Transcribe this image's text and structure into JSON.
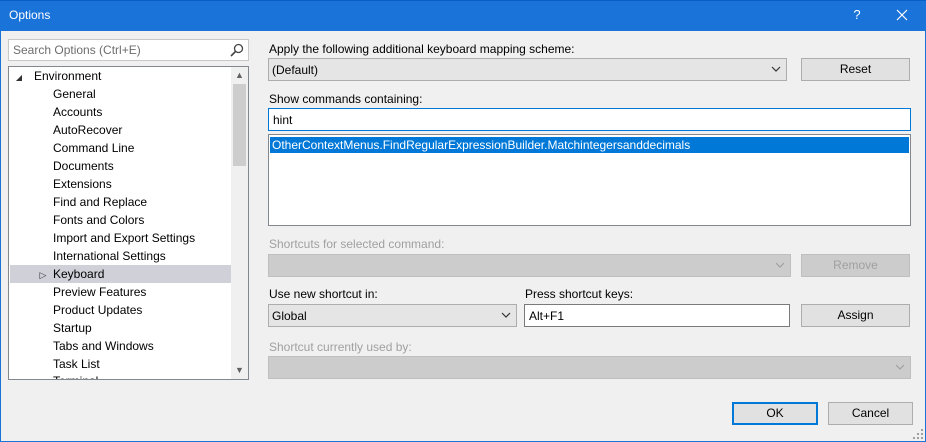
{
  "window": {
    "title": "Options",
    "help": "?",
    "close": "✕"
  },
  "search": {
    "placeholder": "Search Options (Ctrl+E)"
  },
  "tree": {
    "items": [
      {
        "label": "Environment",
        "level": 0,
        "expanded": true
      },
      {
        "label": "General",
        "level": 1
      },
      {
        "label": "Accounts",
        "level": 1
      },
      {
        "label": "AutoRecover",
        "level": 1
      },
      {
        "label": "Command Line",
        "level": 1
      },
      {
        "label": "Documents",
        "level": 1
      },
      {
        "label": "Extensions",
        "level": 1
      },
      {
        "label": "Find and Replace",
        "level": 1
      },
      {
        "label": "Fonts and Colors",
        "level": 1
      },
      {
        "label": "Import and Export Settings",
        "level": 1
      },
      {
        "label": "International Settings",
        "level": 1
      },
      {
        "label": "Keyboard",
        "level": 1,
        "selected": true,
        "collapsed_child": true
      },
      {
        "label": "Preview Features",
        "level": 1
      },
      {
        "label": "Product Updates",
        "level": 1
      },
      {
        "label": "Startup",
        "level": 1
      },
      {
        "label": "Tabs and Windows",
        "level": 1
      },
      {
        "label": "Task List",
        "level": 1
      },
      {
        "label": "Terminal",
        "level": 1
      }
    ]
  },
  "mapping": {
    "label": "Apply the following additional keyboard mapping scheme:",
    "value": "(Default)",
    "reset": "Reset"
  },
  "commands": {
    "label": "Show commands containing:",
    "filter": "hint",
    "selected": "OtherContextMenus.FindRegularExpressionBuilder.Matchintegersanddecimals"
  },
  "shortcuts": {
    "label": "Shortcuts for selected command:",
    "value": "",
    "remove": "Remove"
  },
  "new_shortcut": {
    "use_label": "Use new shortcut in:",
    "use_value": "Global",
    "press_label": "Press shortcut keys:",
    "press_value": "Alt+F1",
    "assign": "Assign"
  },
  "used_by": {
    "label": "Shortcut currently used by:",
    "value": ""
  },
  "footer": {
    "ok": "OK",
    "cancel": "Cancel"
  },
  "colors": {
    "titlebar": "#1a73d9",
    "selection": "#0078d7",
    "tree_selection": "#cfd0d8"
  }
}
